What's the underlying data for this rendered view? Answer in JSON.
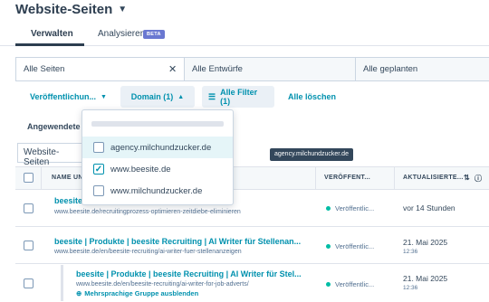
{
  "header": {
    "title": "Website-Seiten"
  },
  "tabs": [
    {
      "label": "Verwalten"
    },
    {
      "label": "Analysieren",
      "badge": "BETA"
    }
  ],
  "views": [
    "Alle Seiten",
    "Alle Entwürfe",
    "Alle geplanten"
  ],
  "filters": {
    "published": "Veröffentlichun...",
    "domain": "Domain (1)",
    "all_filters": "Alle Filter (1)",
    "clear": "Alle löschen",
    "applied": "Angewendete F"
  },
  "search": {
    "value": "Website-Seiten"
  },
  "table": {
    "columns": [
      "NAME UN",
      "VERÖFFENT...",
      "AKTUALISIERTE..."
    ],
    "rows": [
      {
        "title": "beesite | ",
        "url": "www.beesite.de/recruitingprozess-optimieren-zeitdiebe-eliminieren",
        "status": "Veröffentlic...",
        "updated": "vor 14 Stunden",
        "time": ""
      },
      {
        "title": "beesite | Produkte | beesite Recruiting | AI Writer für Stellenan...",
        "url": "www.beesite.de/en/beesite-recruiting/ai-writer-fuer-stellenanzeigen",
        "status": "Veröffentlic...",
        "updated": "21. Mai 2025",
        "time": "12:36"
      },
      {
        "title": "beesite | Produkte | beesite Recruiting | AI Writer für Stel...",
        "url": "www.beesite.de/en/beesite-recruiting/ai-writer-for-job-adverts/",
        "multi": "Mehrsprachige Gruppe ausblenden",
        "status": "Veröffentlic...",
        "updated": "21. Mai 2025",
        "time": "12:36"
      }
    ]
  },
  "dropdown": {
    "options": [
      {
        "label": "agency.milchundzucker.de",
        "checked": false
      },
      {
        "label": "www.beesite.de",
        "checked": true
      },
      {
        "label": "www.milchundzucker.de",
        "checked": false
      }
    ]
  },
  "tooltip": "agency.milchundzucker.de",
  "colors": {
    "accent": "#0091ae",
    "status_green": "#00bda5",
    "beta_badge": "#6a78d1"
  }
}
